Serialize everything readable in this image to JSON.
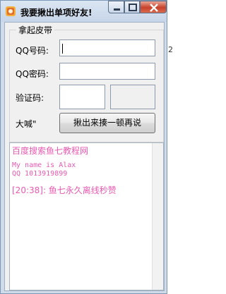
{
  "window": {
    "title": "我要揪出单项好友!",
    "controls": {
      "minimize_icon": "minimize-icon",
      "maximize_icon": "maximize-icon",
      "close_icon": "close-icon"
    }
  },
  "group": {
    "title": "拿起皮带"
  },
  "form": {
    "qq_label": "QQ号码:",
    "qq_value": "",
    "password_label": "QQ密码:",
    "password_value": "",
    "captcha_label": "验证码:",
    "captcha_value": "",
    "shout_label": "大喊\"",
    "action_button": "揪出来揍一顿再说"
  },
  "log": {
    "lines": [
      "百度搜索鱼七教程网",
      "My name is Alax",
      "QQ   1013919899",
      "[20:38]: 鱼七永久离线秒赞"
    ]
  },
  "background": {
    "edge_text": "2"
  },
  "colors": {
    "log_text": "#e85ab0",
    "titlebar": "#c6d5e8",
    "close": "#c8412a"
  }
}
